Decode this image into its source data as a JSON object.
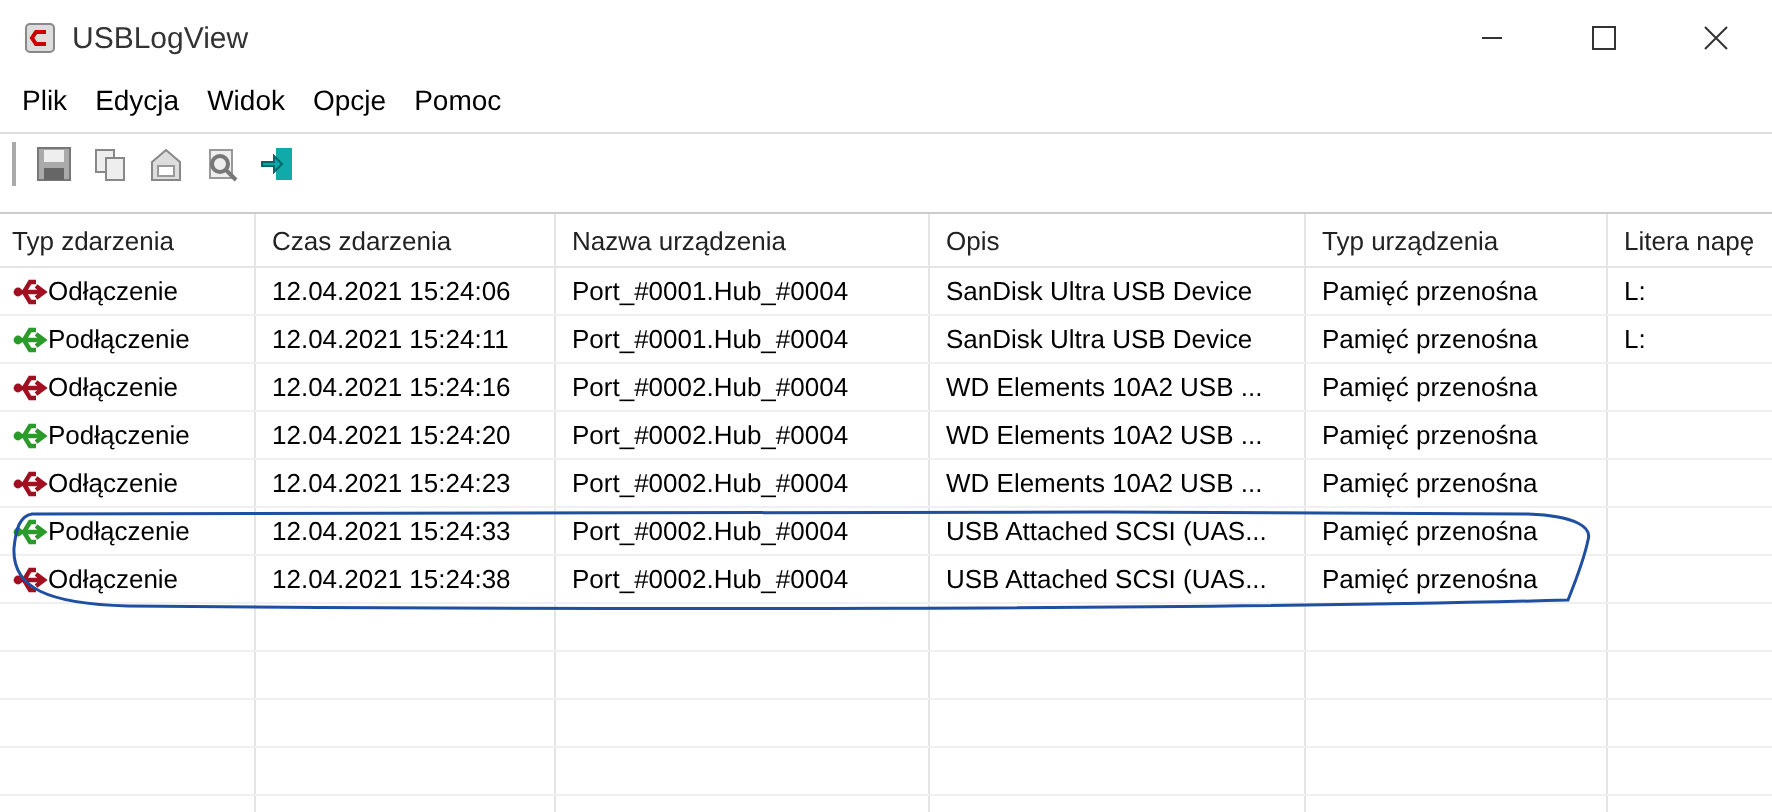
{
  "window": {
    "title": "USBLogView"
  },
  "menu": [
    "Plik",
    "Edycja",
    "Widok",
    "Opcje",
    "Pomoc"
  ],
  "table": {
    "columns": [
      "Typ zdarzenia",
      "Czas zdarzenia",
      "Nazwa urządzenia",
      "Opis",
      "Typ urządzenia",
      "Litera napę"
    ],
    "rows": [
      {
        "kind": "disconnect",
        "circled": false,
        "cells": [
          "Odłączenie",
          "12.04.2021 15:24:06",
          "Port_#0001.Hub_#0004",
          "SanDisk Ultra USB Device",
          "Pamięć przenośna",
          "L:"
        ]
      },
      {
        "kind": "connect",
        "circled": false,
        "cells": [
          "Podłączenie",
          "12.04.2021 15:24:11",
          "Port_#0001.Hub_#0004",
          "SanDisk Ultra USB Device",
          "Pamięć przenośna",
          "L:"
        ]
      },
      {
        "kind": "disconnect",
        "circled": false,
        "cells": [
          "Odłączenie",
          "12.04.2021 15:24:16",
          "Port_#0002.Hub_#0004",
          "WD Elements 10A2 USB ...",
          "Pamięć przenośna",
          ""
        ]
      },
      {
        "kind": "connect",
        "circled": false,
        "cells": [
          "Podłączenie",
          "12.04.2021 15:24:20",
          "Port_#0002.Hub_#0004",
          "WD Elements 10A2 USB ...",
          "Pamięć przenośna",
          ""
        ]
      },
      {
        "kind": "disconnect",
        "circled": false,
        "cells": [
          "Odłączenie",
          "12.04.2021 15:24:23",
          "Port_#0002.Hub_#0004",
          "WD Elements 10A2 USB ...",
          "Pamięć przenośna",
          ""
        ]
      },
      {
        "kind": "connect",
        "circled": true,
        "cells": [
          "Podłączenie",
          "12.04.2021 15:24:33",
          "Port_#0002.Hub_#0004",
          "USB Attached SCSI (UAS...",
          "Pamięć przenośna",
          ""
        ]
      },
      {
        "kind": "disconnect",
        "circled": true,
        "cells": [
          "Odłączenie",
          "12.04.2021 15:24:38",
          "Port_#0002.Hub_#0004",
          "USB Attached SCSI (UAS...",
          "Pamięć przenośna",
          ""
        ]
      }
    ]
  }
}
